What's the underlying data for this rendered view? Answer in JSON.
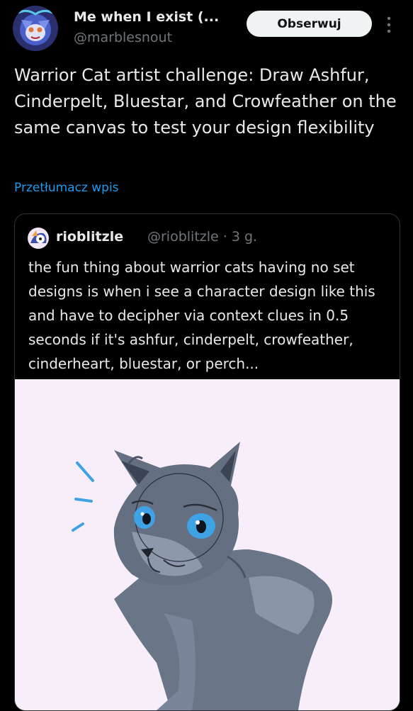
{
  "author": {
    "name": "Me when I exist (...",
    "handle": "@marblesnout",
    "avatar_icon": "avatar-icon"
  },
  "follow_label": "Obserwuj",
  "more_icon": "more-vertical-icon",
  "post_text": "Warrior Cat artist challenge: Draw Ashfur, Cinderpelt, Bluestar, and Crowfeather on the same canvas to test your design flexibility",
  "translate_label": "Przetłumacz wpis",
  "quote": {
    "name": "rioblitzle",
    "handle": "@rioblitzle",
    "time": "· 3 g.",
    "text": "the fun thing about warrior cats having no set designs is when i see a character design like this and have to decipher via context clues in 0.5 seconds if it's ashfur, cinderpelt, crowfeather, cinderheart, bluestar, or perch...",
    "media": "cat-drawing-image"
  },
  "colors": {
    "background": "#000000",
    "text": "#e7e9ea",
    "muted": "#71767b",
    "link": "#1d9bf0",
    "media_bg": "#f8eefa",
    "cat_gray": "#697687",
    "cat_eye": "#3fa2e4"
  }
}
